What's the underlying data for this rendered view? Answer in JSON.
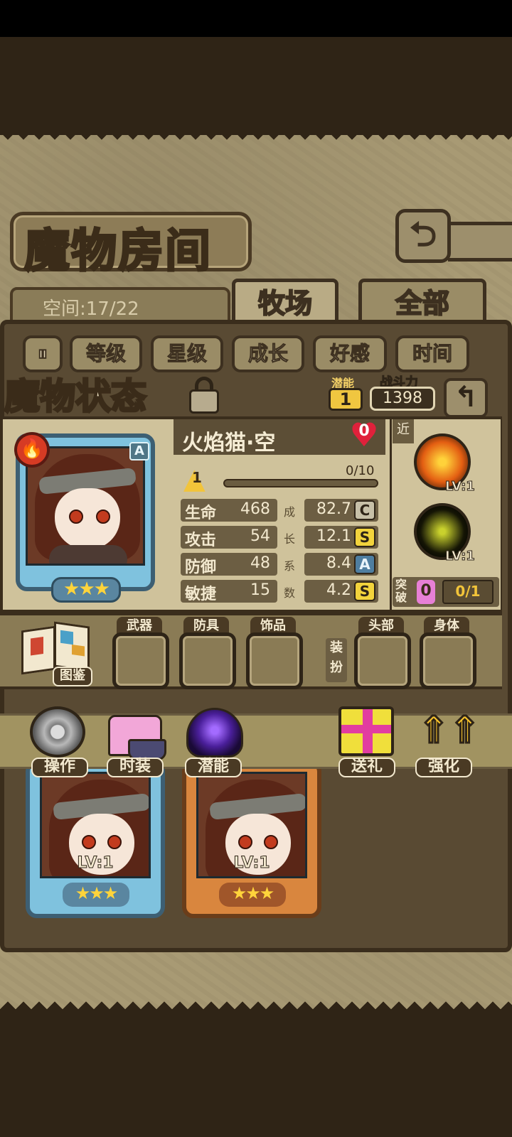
{
  "page": {
    "title": "魔物房间",
    "space_label": "空间:17/22",
    "tabs": [
      {
        "label": "牧场",
        "active": true
      },
      {
        "label": "全部",
        "active": false
      }
    ]
  },
  "filters": {
    "toggle_icon": "sort-toggle-icon",
    "items": [
      "等级",
      "星级",
      "成长",
      "好感",
      "时间"
    ]
  },
  "status": {
    "title": "魔物状态",
    "potential_label": "潜能",
    "potential_value": "1",
    "power_label": "战斗力",
    "power_value": "1398"
  },
  "monster": {
    "name": "火焰猫·空",
    "element": "fire",
    "rank": "A",
    "stars": 3,
    "affection": "0",
    "level": "1",
    "exp": "0/10",
    "exp_fraction": 0,
    "growth_label": "成长系数",
    "stats": [
      {
        "name": "生命",
        "value": "468",
        "growth": "82.7",
        "grade": "C"
      },
      {
        "name": "攻击",
        "value": "54",
        "growth": "12.1",
        "grade": "S"
      },
      {
        "name": "防御",
        "value": "48",
        "growth": "8.4",
        "grade": "A"
      },
      {
        "name": "敏捷",
        "value": "15",
        "growth": "4.2",
        "grade": "S"
      }
    ],
    "range": "近",
    "skills": [
      {
        "icon": "fire-skill-icon",
        "level": "LV:1"
      },
      {
        "icon": "wind-skill-icon",
        "level": "LV:1"
      }
    ],
    "breakthrough": {
      "label": "突破",
      "count": "0",
      "progress": "0/1"
    }
  },
  "equipment": {
    "book_label": "图鉴",
    "equip_label": "装扮",
    "slots": [
      "武器",
      "防具",
      "饰品",
      "头部",
      "身体"
    ]
  },
  "actions": [
    "操作",
    "时装",
    "潜能",
    "送礼",
    "强化"
  ],
  "cards": [
    {
      "level": "LV:1",
      "stars": 3,
      "frame": "blue"
    },
    {
      "level": "LV:1",
      "stars": 3,
      "frame": "orange"
    }
  ],
  "colors": {
    "frame_dark": "#3a2d1c",
    "parchment": "#cfc29b",
    "accent_gold": "#f2c43a",
    "affection_red": "#e0213b",
    "breakthrough_pink": "#e780d6"
  }
}
